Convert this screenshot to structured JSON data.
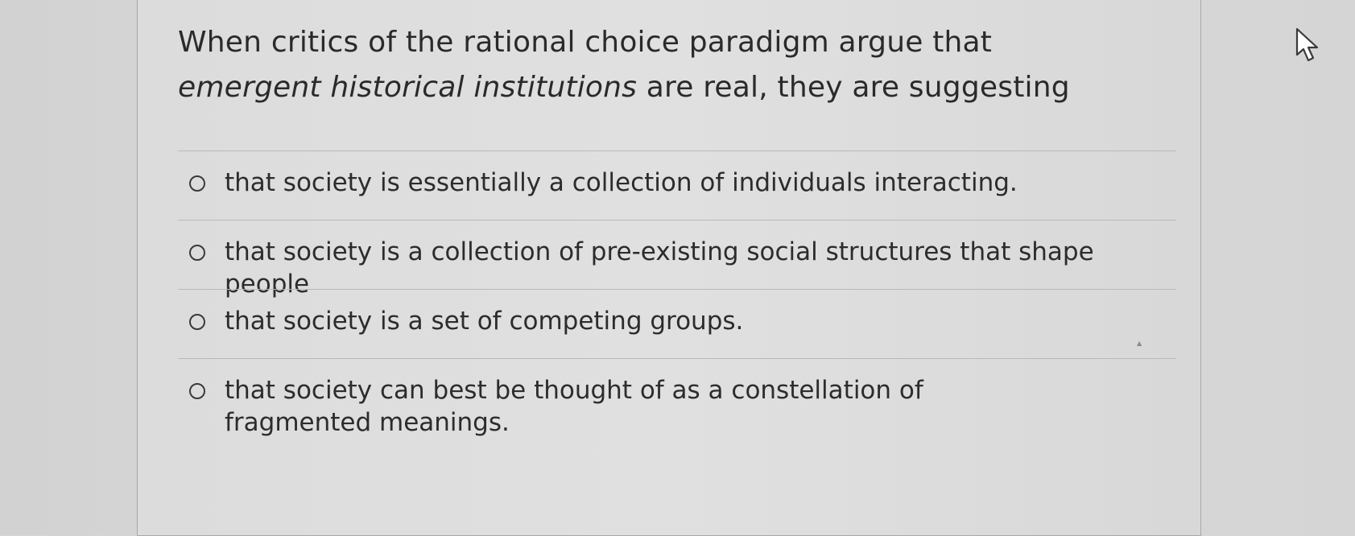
{
  "question": {
    "text_part1": "When critics of the rational choice paradigm argue that ",
    "text_emphasis": "emergent historical institutions",
    "text_part2": " are real, they are suggesting"
  },
  "options": [
    {
      "label": "that society is essentially a collection of individuals interacting.",
      "selected": false
    },
    {
      "label": "that society is a collection of pre-existing social structures that shape people",
      "selected": false
    },
    {
      "label": "that society is a set of competing groups.",
      "selected": false
    },
    {
      "label": "that society can best be thought of as a constellation of fragmented meanings.",
      "selected": false
    }
  ],
  "icons": {
    "radio": "radio-circle-icon",
    "cursor": "mouse-pointer-icon"
  },
  "colors": {
    "text": "#2a2a2a",
    "background": "#dcdcdc",
    "divider": "#b9b9b9"
  }
}
